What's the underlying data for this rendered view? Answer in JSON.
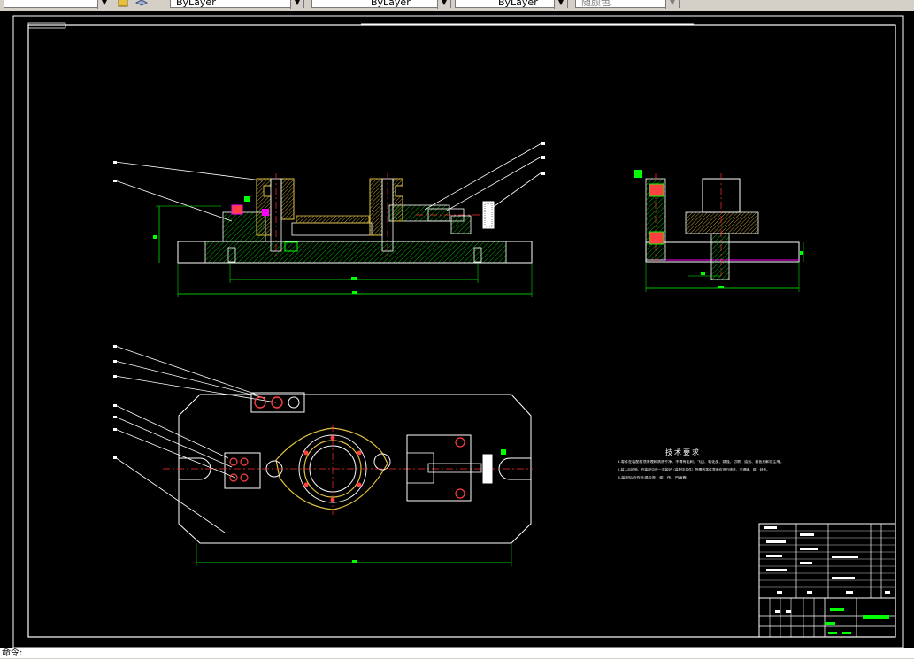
{
  "toolbar": {
    "color_combo": "ByLayer",
    "linetype_combo": "ByLayer",
    "lineweight_combo": "ByLayer",
    "plotstyle_combo": "随颜色"
  },
  "drawing": {
    "tech_title": "技术要求",
    "tech_notes": [
      "1.零件在装配前须清理和清洗干净，不得有毛刺、飞边、氧化皮、锈蚀、切屑、油污、着色剂和灰尘等。",
      "2.装入后检验，在装配中应一次装好（装配中零件）所需的零件表面应进行清洗，不得磕、碰、划伤。",
      "3.装配后应作外观检查，碰、伤、凹痕等。"
    ]
  },
  "command_line": {
    "prompt": "命令:"
  }
}
